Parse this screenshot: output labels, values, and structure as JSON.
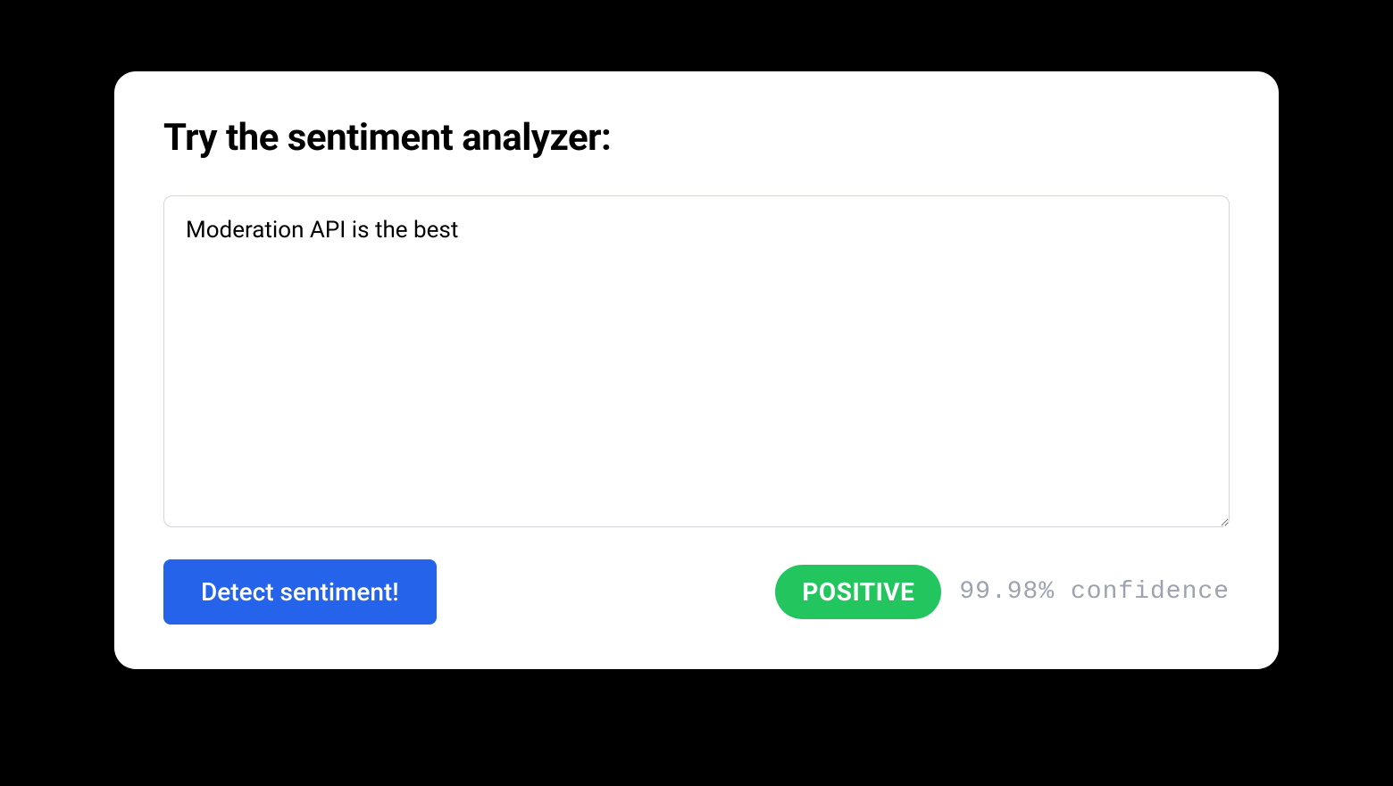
{
  "heading": "Try the sentiment analyzer:",
  "textarea": {
    "value": "Moderation API is the best"
  },
  "button": {
    "label": "Detect sentiment!"
  },
  "result": {
    "sentiment": "POSITIVE",
    "confidence": "99.98% confidence"
  },
  "colors": {
    "primary": "#2563eb",
    "positive": "#22c55e",
    "muted": "#9ca3af"
  }
}
